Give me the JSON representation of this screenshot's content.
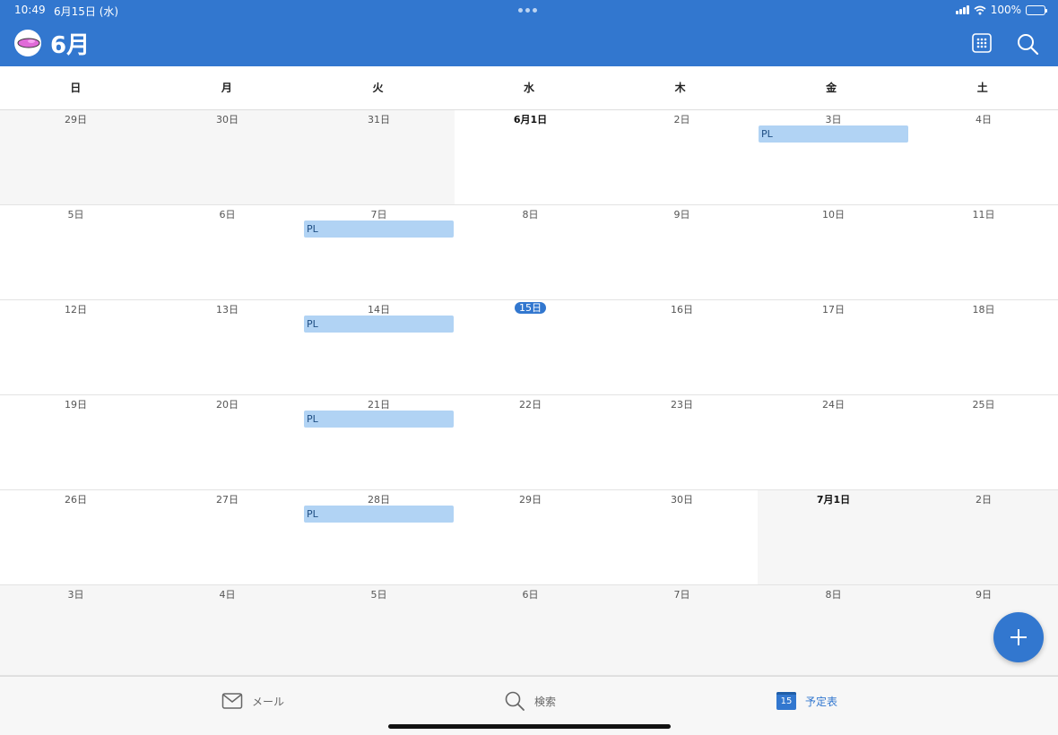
{
  "status_bar": {
    "time": "10:49",
    "date": "6月15日 (水)",
    "battery": "100%"
  },
  "header": {
    "title": "6月",
    "grid_icon": "grid-icon",
    "search_icon": "search-icon"
  },
  "weekdays": [
    "日",
    "月",
    "火",
    "水",
    "木",
    "金",
    "土"
  ],
  "weeks": [
    {
      "days": [
        {
          "label": "29日",
          "out": true
        },
        {
          "label": "30日",
          "out": true
        },
        {
          "label": "31日",
          "out": true
        },
        {
          "label": "6月1日",
          "bold": true
        },
        {
          "label": "2日"
        },
        {
          "label": "3日"
        },
        {
          "label": "4日"
        }
      ],
      "events": [
        {
          "label": "PL",
          "day": 5
        }
      ]
    },
    {
      "days": [
        {
          "label": "5日"
        },
        {
          "label": "6日"
        },
        {
          "label": "7日"
        },
        {
          "label": "8日"
        },
        {
          "label": "9日"
        },
        {
          "label": "10日"
        },
        {
          "label": "11日"
        }
      ],
      "events": [
        {
          "label": "PL",
          "day": 2
        }
      ]
    },
    {
      "days": [
        {
          "label": "12日"
        },
        {
          "label": "13日"
        },
        {
          "label": "14日"
        },
        {
          "label": "15日",
          "today": true
        },
        {
          "label": "16日"
        },
        {
          "label": "17日"
        },
        {
          "label": "18日"
        }
      ],
      "events": [
        {
          "label": "PL",
          "day": 2
        }
      ]
    },
    {
      "days": [
        {
          "label": "19日"
        },
        {
          "label": "20日"
        },
        {
          "label": "21日"
        },
        {
          "label": "22日"
        },
        {
          "label": "23日"
        },
        {
          "label": "24日"
        },
        {
          "label": "25日"
        }
      ],
      "events": [
        {
          "label": "PL",
          "day": 2
        }
      ]
    },
    {
      "days": [
        {
          "label": "26日"
        },
        {
          "label": "27日"
        },
        {
          "label": "28日"
        },
        {
          "label": "29日"
        },
        {
          "label": "30日"
        },
        {
          "label": "7月1日",
          "out": true,
          "bold": true
        },
        {
          "label": "2日",
          "out": true
        }
      ],
      "events": [
        {
          "label": "PL",
          "day": 2
        }
      ]
    },
    {
      "days": [
        {
          "label": "3日",
          "out": true
        },
        {
          "label": "4日",
          "out": true
        },
        {
          "label": "5日",
          "out": true
        },
        {
          "label": "6日",
          "out": true
        },
        {
          "label": "7日",
          "out": true
        },
        {
          "label": "8日",
          "out": true
        },
        {
          "label": "9日",
          "out": true
        }
      ],
      "events": []
    }
  ],
  "fab": {
    "icon": "plus-icon"
  },
  "tabbar": {
    "mail": {
      "label": "メール",
      "icon": "mail-icon"
    },
    "search": {
      "label": "検索",
      "icon": "search-icon"
    },
    "calendar": {
      "label": "予定表",
      "icon": "calendar-icon",
      "icon_text": "15",
      "active": true
    }
  },
  "colors": {
    "accent": "#3277cf",
    "event_fill": "#b1d3f4",
    "out_of_month": "#f6f6f6"
  }
}
